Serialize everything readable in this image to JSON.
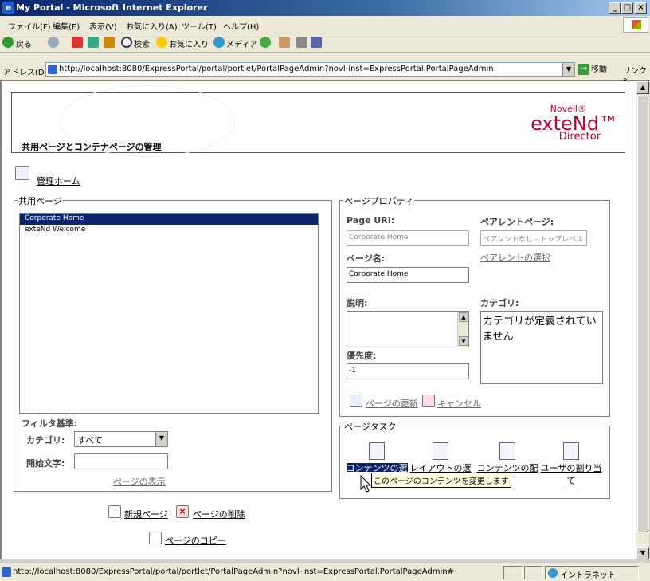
{
  "window": {
    "title": "My Portal - Microsoft Internet Explorer"
  },
  "menu": [
    "ファイル(F)",
    "編集(E)",
    "表示(V)",
    "お気に入り(A)",
    "ツール(T)",
    "ヘルプ(H)"
  ],
  "toolbar": {
    "back": "戻る",
    "search": "検索",
    "favorites": "お気に入り",
    "media": "メディア"
  },
  "address": {
    "label": "アドレス(D)",
    "url": "http://localhost:8080/ExpressPortal/portal/portlet/PortalPageAdmin?novl-inst=ExpressPortal.PortalPageAdmin",
    "go": "移動",
    "links": "リンク »"
  },
  "banner": {
    "title": "共用ページとコンテナページの管理",
    "brand_novell": "Novell®",
    "brand_extend": "exteNd™",
    "brand_director": "Director"
  },
  "admin_home": "管理ホーム",
  "shared_pages": {
    "legend": "共用ページ",
    "items": [
      "Corporate Home",
      "exteNd Welcome"
    ],
    "filter_label": "フィルタ基準:",
    "category_label": "カテゴリ:",
    "category_value": "すべて",
    "start_label": "開始文字:",
    "show_pages": "ページの表示"
  },
  "page_properties": {
    "legend": "ページプロパティ",
    "uri_label": "Page URI:",
    "uri_value": "Corporate Home",
    "parent_label": "ペアレントページ:",
    "parent_value": "ペアレントなし - トップレベル",
    "select_parent": "ペアレントの選択",
    "name_label": "ページ名:",
    "name_value": "Corporate Home",
    "desc_label": "説明:",
    "category_label": "カテゴリ:",
    "category_text": "カテゴリが定義されていません",
    "priority_label": "優先度:",
    "priority_value": "-1",
    "update": "ページの更新",
    "cancel": "キャンセル"
  },
  "page_tasks": {
    "legend": "ページタスク",
    "items": [
      {
        "line1": "コンテンツの選",
        "line2": "択"
      },
      {
        "line1": "レイアウトの選",
        "line2": "択"
      },
      {
        "line1": "コンテンツの配",
        "line2": "置"
      },
      {
        "line1": "ユーザの割り当",
        "line2": "て"
      }
    ],
    "tooltip": "このページのコンテンツを変更します"
  },
  "actions": {
    "new_page": "新規ページ",
    "delete_page": "ページの削除",
    "copy_page": "ページのコピー"
  },
  "status": {
    "url": "http://localhost:8080/ExpressPortal/portal/portlet/PortalPageAdmin?novl-inst=ExpressPortal.PortalPageAdmin#",
    "zone": "イントラネット"
  }
}
